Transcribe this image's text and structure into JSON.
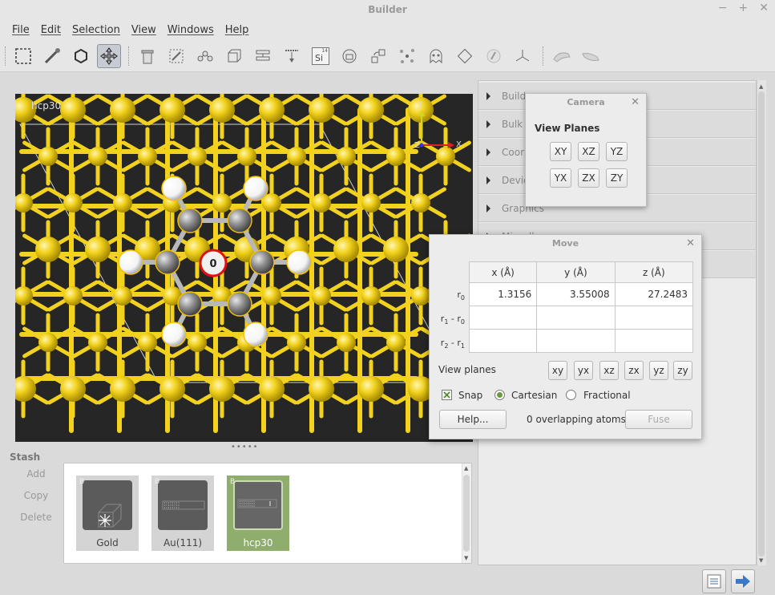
{
  "window": {
    "title": "Builder",
    "controls": [
      "−",
      "+",
      "✕"
    ]
  },
  "menu": [
    "File",
    "Edit",
    "Selection",
    "View",
    "Windows",
    "Help"
  ],
  "toolbar": {
    "icons": [
      "select-icon",
      "pipette-icon",
      "hexagon-icon",
      "move-icon",
      "trash-icon",
      "transform-icon",
      "molecule-icon",
      "cell-icon",
      "slab-icon",
      "cleave-icon",
      "element-icon",
      "lock-icon",
      "translate-icon",
      "scatter-icon",
      "ghost-icon",
      "rotate-icon",
      "paint-icon",
      "axes-icon",
      "hand-icon",
      "hand2-icon"
    ],
    "element_badge": {
      "symbol": "Si",
      "number": "14"
    },
    "active_index": 3
  },
  "viewport": {
    "label": "hcp30",
    "axes": {
      "y": "Y",
      "x": "X",
      "z": "Z"
    },
    "selected_atom_label": "0"
  },
  "right_panel": {
    "sections": [
      "Builder",
      "Bulk",
      "Coordinates",
      "Devices",
      "Graphics",
      "Miscellaneous"
    ],
    "visible_labels": [
      "Build",
      "Bulk",
      "Coor",
      "Devic",
      "Graphics",
      "Miscell"
    ]
  },
  "camera": {
    "title": "Camera",
    "heading": "View Planes",
    "buttons": [
      "XY",
      "XZ",
      "YZ",
      "YX",
      "ZX",
      "ZY"
    ]
  },
  "move": {
    "title": "Move",
    "columns": [
      "x (Å)",
      "y (Å)",
      "z (Å)"
    ],
    "rows": [
      {
        "label": "r0",
        "values": [
          "1.3156",
          "3.55008",
          "27.2483"
        ]
      },
      {
        "label": "r1 - r0",
        "values": [
          "",
          "",
          ""
        ]
      },
      {
        "label": "r2 - r1",
        "values": [
          "",
          "",
          ""
        ]
      }
    ],
    "view_planes_label": "View planes",
    "view_planes": [
      "xy",
      "yx",
      "xz",
      "zx",
      "yz",
      "zy"
    ],
    "snap_label": "Snap",
    "snap_checked": true,
    "cartesian_label": "Cartesian",
    "fractional_label": "Fractional",
    "coordinate_mode": "Cartesian",
    "help_label": "Help...",
    "overlap_text": "0 overlapping atoms",
    "fuse_label": "Fuse"
  },
  "stash": {
    "label": "Stash",
    "actions": [
      "Add",
      "Copy",
      "Delete"
    ],
    "items": [
      {
        "name": "Gold",
        "badge": "B",
        "selected": false
      },
      {
        "name": "Au(111)",
        "badge": "B",
        "selected": false
      },
      {
        "name": "hcp30",
        "badge": "B",
        "selected": true
      }
    ]
  },
  "colors": {
    "gold": "#f2d21e",
    "carbon": "#8e8e8e",
    "hydrogen": "#f4f4f4",
    "selected_ring": "#e01010",
    "stash_selected": "#8fad6d"
  }
}
